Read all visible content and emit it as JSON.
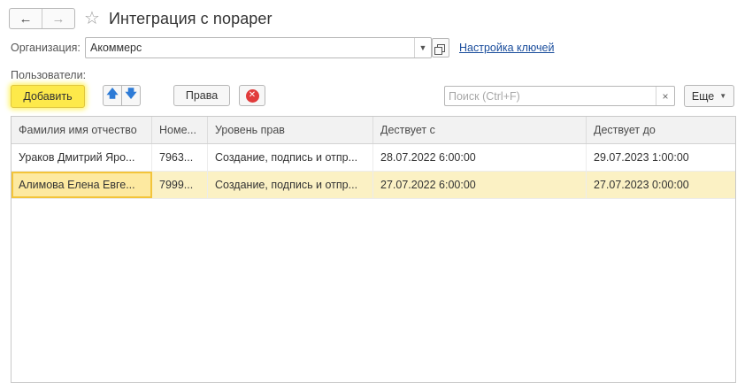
{
  "window": {
    "title": "Интеграция с nopaper"
  },
  "organization": {
    "label": "Организация:",
    "value": "Акоммерс",
    "keys_link": "Настройка ключей"
  },
  "users": {
    "label": "Пользователи:"
  },
  "toolbar": {
    "add_label": "Добавить",
    "rights_label": "Права",
    "search_placeholder": "Поиск (Ctrl+F)",
    "more_label": "Еще"
  },
  "icons": {
    "back": "arrow-left-icon",
    "forward": "arrow-right-icon",
    "favorite": "star-icon",
    "up": "arrow-up-icon",
    "down": "arrow-down-icon",
    "delete": "delete-icon",
    "clear": "clear-icon"
  },
  "colors": {
    "highlight": "#fde94a",
    "selected_row": "#fbf1c4",
    "link": "#1a4d9c",
    "delete": "#e13b3b",
    "arrow": "#2e7bd6"
  },
  "table": {
    "columns": [
      "Фамилия имя отчество",
      "Номе...",
      "Уровень прав",
      "Дествует с",
      "Дествует до"
    ],
    "rows": [
      [
        "Ураков Дмитрий Яро...",
        "7963...",
        "Создание, подпись и отпр...",
        "28.07.2022 6:00:00",
        "29.07.2023 1:00:00"
      ],
      [
        "Алимова Елена Евге...",
        "7999...",
        "Создание, подпись и отпр...",
        "27.07.2022 6:00:00",
        "27.07.2023 0:00:00"
      ]
    ],
    "selected_row": 1
  }
}
